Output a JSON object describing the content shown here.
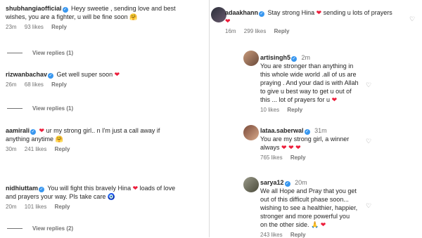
{
  "left_comments": [
    {
      "username": "shubhangiaofficial",
      "lines": [
        "Heyy sweetie , sending love and best",
        "wishes, you are a fighter, u will be fine soon"
      ],
      "emoji_end": "🤗",
      "time": "23m",
      "likes": "93 likes",
      "reply": "Reply",
      "view_replies": "View replies (1)"
    },
    {
      "username": "rizwanbachav",
      "lines": [
        "Get well super soon"
      ],
      "emoji_end": "❤",
      "time": "26m",
      "likes": "68 likes",
      "reply": "Reply",
      "view_replies": "View replies (1)"
    },
    {
      "username": "aamirali",
      "lines": [
        "ur my strong girl.. n I'm just a call away if",
        "anything anytime"
      ],
      "emoji_start": "❤",
      "emoji_end": "🤗",
      "time": "30m",
      "likes": "241 likes",
      "reply": "Reply"
    },
    {
      "username": "nidhiuttam",
      "lines": [
        "You will fight this bravely Hina",
        "loads of love",
        "and prayers your way. Pls take care"
      ],
      "emoji_mid": "❤",
      "emoji_end": "🧿",
      "time": "20m",
      "likes": "101 likes",
      "reply": "Reply",
      "view_replies": "View replies (2)"
    }
  ],
  "right_comments": [
    {
      "username": "adaakhann",
      "lines": [
        "Stay strong Hina",
        "sending u lots of prayers"
      ],
      "emoji_mid": "❤",
      "emoji_line2": "❤",
      "time": "16m",
      "likes": "299 likes",
      "reply": "Reply"
    },
    {
      "username": "artisingh5",
      "time": "2m",
      "lines": [
        "You are stronger than anything in",
        "this whole wide world .all of us are",
        "praying . And your dad is with Allah",
        "to give u best way to get u out of",
        "this ... lot of prayers for u"
      ],
      "emoji_end": "❤",
      "likes": "10 likes",
      "reply": "Reply"
    },
    {
      "username": "lataa.saberwal",
      "time": "31m",
      "lines": [
        "You are my strong girl, a winner",
        "always"
      ],
      "emoji_end": "❤ ❤ ❤",
      "likes": "765 likes",
      "reply": "Reply"
    },
    {
      "username": "sarya12",
      "time": "20m",
      "lines": [
        "We all Hope and Pray that you get",
        "out of this difficult phase soon...",
        "wishing to see a healthier, happier,",
        "stronger and more powerful you",
        "on the other side."
      ],
      "emoji_end": "🙏 ❤",
      "likes": "243 likes",
      "reply": "Reply"
    }
  ],
  "colors": {
    "heart": "#ed1c3a",
    "verified": "#3897f0",
    "muted": "#737373"
  }
}
